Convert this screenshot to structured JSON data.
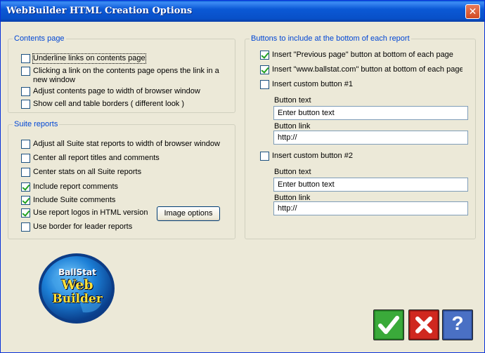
{
  "window": {
    "title": "WebBuilder HTML Creation Options",
    "close_glyph": "✕"
  },
  "contents_page": {
    "legend": "Contents page",
    "options": [
      {
        "label": "Underline links on contents page",
        "checked": false
      },
      {
        "label": "Clicking a link on the contents page opens the link in a new window",
        "checked": false
      },
      {
        "label": "Adjust contents page to width of browser window",
        "checked": false
      },
      {
        "label": "Show cell and table borders ( different look )",
        "checked": false
      }
    ]
  },
  "suite_reports": {
    "legend": "Suite reports",
    "options": [
      {
        "label": "Adjust all Suite stat reports to width of browser window",
        "checked": false
      },
      {
        "label": "Center all report titles and comments",
        "checked": false
      },
      {
        "label": "Center stats on all Suite reports",
        "checked": false
      },
      {
        "label": "Include report comments",
        "checked": true
      },
      {
        "label": "Include Suite comments",
        "checked": true
      },
      {
        "label": "Use report logos in HTML version",
        "checked": true
      },
      {
        "label": "Use border for leader reports",
        "checked": false
      }
    ],
    "image_options_button": "Image options"
  },
  "buttons_group": {
    "legend": "Buttons to include at the bottom of each report",
    "options": [
      {
        "label": "Insert \"Previous page\" button at bottom of each page",
        "checked": true
      },
      {
        "label": "Insert \"www.ballstat.com\" button at bottom of each page",
        "checked": true
      },
      {
        "label": "Insert custom button #1",
        "checked": false
      },
      {
        "label": "Insert custom button #2",
        "checked": false
      }
    ],
    "custom1": {
      "text_label": "Button text",
      "text_value": "Enter button text",
      "link_label": "Button link",
      "link_value": "http://"
    },
    "custom2": {
      "text_label": "Button text",
      "text_value": "Enter button text",
      "link_label": "Button link",
      "link_value": "http://"
    }
  },
  "logo": {
    "line1": "BallStat",
    "line2": "Web",
    "line3": "Builder"
  },
  "footer_buttons": {
    "ok_icon": "checkmark-icon",
    "cancel_icon": "x-icon",
    "help_icon": "question-icon",
    "help_glyph": "?"
  },
  "colors": {
    "ok": "#2f9a2f",
    "cancel": "#c0201a",
    "help": "#3a5fb0",
    "legend": "#0046d5",
    "check": "#21a121"
  }
}
